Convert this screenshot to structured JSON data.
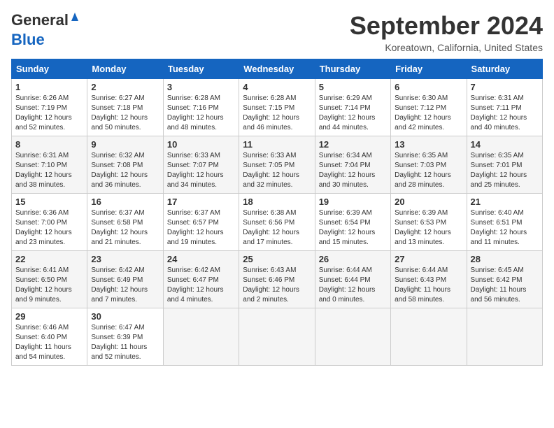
{
  "header": {
    "logo_general": "General",
    "logo_blue": "Blue",
    "month_title": "September 2024",
    "location": "Koreatown, California, United States"
  },
  "days_of_week": [
    "Sunday",
    "Monday",
    "Tuesday",
    "Wednesday",
    "Thursday",
    "Friday",
    "Saturday"
  ],
  "weeks": [
    [
      {
        "day": "1",
        "sunrise": "6:26 AM",
        "sunset": "7:19 PM",
        "daylight": "12 hours and 52 minutes."
      },
      {
        "day": "2",
        "sunrise": "6:27 AM",
        "sunset": "7:18 PM",
        "daylight": "12 hours and 50 minutes."
      },
      {
        "day": "3",
        "sunrise": "6:28 AM",
        "sunset": "7:16 PM",
        "daylight": "12 hours and 48 minutes."
      },
      {
        "day": "4",
        "sunrise": "6:28 AM",
        "sunset": "7:15 PM",
        "daylight": "12 hours and 46 minutes."
      },
      {
        "day": "5",
        "sunrise": "6:29 AM",
        "sunset": "7:14 PM",
        "daylight": "12 hours and 44 minutes."
      },
      {
        "day": "6",
        "sunrise": "6:30 AM",
        "sunset": "7:12 PM",
        "daylight": "12 hours and 42 minutes."
      },
      {
        "day": "7",
        "sunrise": "6:31 AM",
        "sunset": "7:11 PM",
        "daylight": "12 hours and 40 minutes."
      }
    ],
    [
      {
        "day": "8",
        "sunrise": "6:31 AM",
        "sunset": "7:10 PM",
        "daylight": "12 hours and 38 minutes."
      },
      {
        "day": "9",
        "sunrise": "6:32 AM",
        "sunset": "7:08 PM",
        "daylight": "12 hours and 36 minutes."
      },
      {
        "day": "10",
        "sunrise": "6:33 AM",
        "sunset": "7:07 PM",
        "daylight": "12 hours and 34 minutes."
      },
      {
        "day": "11",
        "sunrise": "6:33 AM",
        "sunset": "7:05 PM",
        "daylight": "12 hours and 32 minutes."
      },
      {
        "day": "12",
        "sunrise": "6:34 AM",
        "sunset": "7:04 PM",
        "daylight": "12 hours and 30 minutes."
      },
      {
        "day": "13",
        "sunrise": "6:35 AM",
        "sunset": "7:03 PM",
        "daylight": "12 hours and 28 minutes."
      },
      {
        "day": "14",
        "sunrise": "6:35 AM",
        "sunset": "7:01 PM",
        "daylight": "12 hours and 25 minutes."
      }
    ],
    [
      {
        "day": "15",
        "sunrise": "6:36 AM",
        "sunset": "7:00 PM",
        "daylight": "12 hours and 23 minutes."
      },
      {
        "day": "16",
        "sunrise": "6:37 AM",
        "sunset": "6:58 PM",
        "daylight": "12 hours and 21 minutes."
      },
      {
        "day": "17",
        "sunrise": "6:37 AM",
        "sunset": "6:57 PM",
        "daylight": "12 hours and 19 minutes."
      },
      {
        "day": "18",
        "sunrise": "6:38 AM",
        "sunset": "6:56 PM",
        "daylight": "12 hours and 17 minutes."
      },
      {
        "day": "19",
        "sunrise": "6:39 AM",
        "sunset": "6:54 PM",
        "daylight": "12 hours and 15 minutes."
      },
      {
        "day": "20",
        "sunrise": "6:39 AM",
        "sunset": "6:53 PM",
        "daylight": "12 hours and 13 minutes."
      },
      {
        "day": "21",
        "sunrise": "6:40 AM",
        "sunset": "6:51 PM",
        "daylight": "12 hours and 11 minutes."
      }
    ],
    [
      {
        "day": "22",
        "sunrise": "6:41 AM",
        "sunset": "6:50 PM",
        "daylight": "12 hours and 9 minutes."
      },
      {
        "day": "23",
        "sunrise": "6:42 AM",
        "sunset": "6:49 PM",
        "daylight": "12 hours and 7 minutes."
      },
      {
        "day": "24",
        "sunrise": "6:42 AM",
        "sunset": "6:47 PM",
        "daylight": "12 hours and 4 minutes."
      },
      {
        "day": "25",
        "sunrise": "6:43 AM",
        "sunset": "6:46 PM",
        "daylight": "12 hours and 2 minutes."
      },
      {
        "day": "26",
        "sunrise": "6:44 AM",
        "sunset": "6:44 PM",
        "daylight": "12 hours and 0 minutes."
      },
      {
        "day": "27",
        "sunrise": "6:44 AM",
        "sunset": "6:43 PM",
        "daylight": "11 hours and 58 minutes."
      },
      {
        "day": "28",
        "sunrise": "6:45 AM",
        "sunset": "6:42 PM",
        "daylight": "11 hours and 56 minutes."
      }
    ],
    [
      {
        "day": "29",
        "sunrise": "6:46 AM",
        "sunset": "6:40 PM",
        "daylight": "11 hours and 54 minutes."
      },
      {
        "day": "30",
        "sunrise": "6:47 AM",
        "sunset": "6:39 PM",
        "daylight": "11 hours and 52 minutes."
      },
      null,
      null,
      null,
      null,
      null
    ]
  ]
}
